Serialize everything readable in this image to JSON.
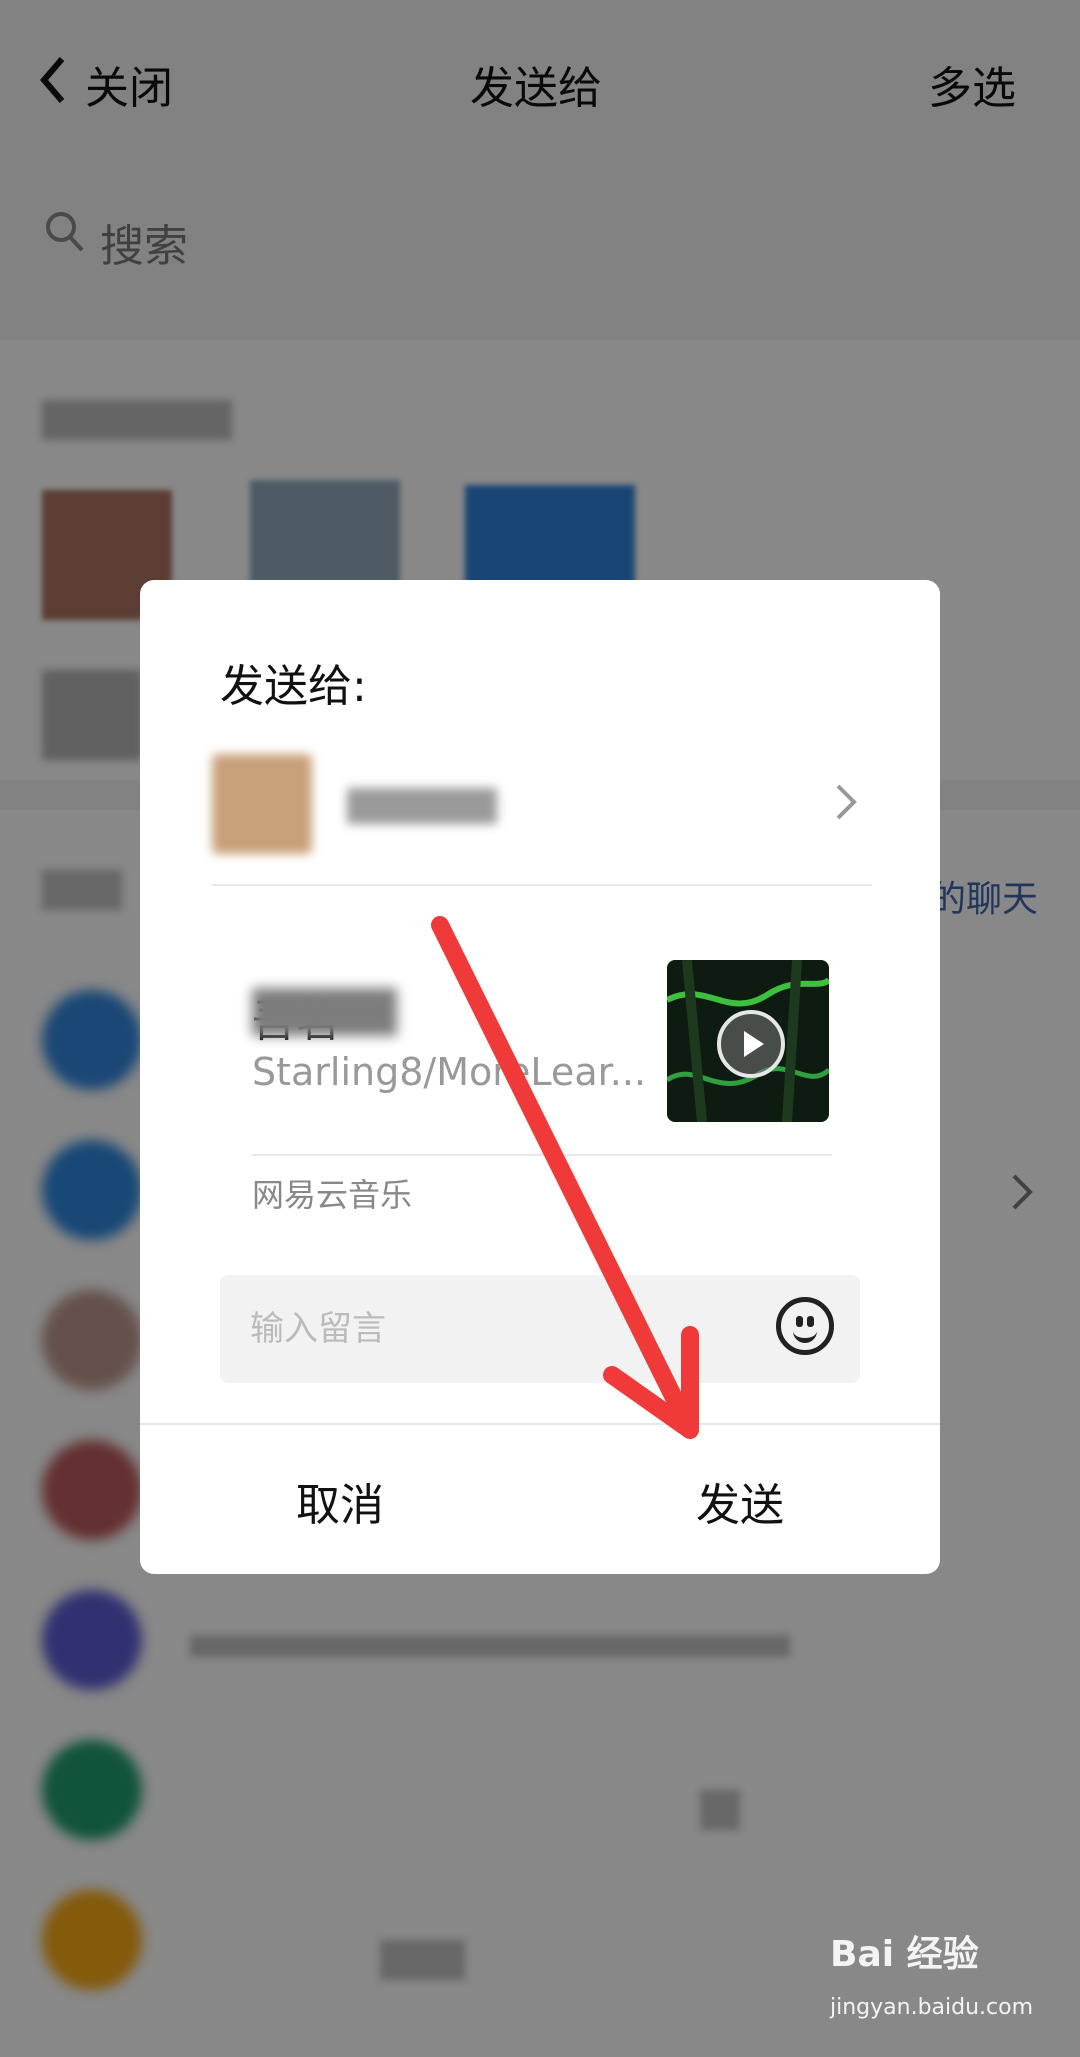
{
  "top_bar": {
    "close_label": "关闭",
    "title": "发送给",
    "multi_select_label": "多选"
  },
  "search": {
    "placeholder": "搜索"
  },
  "background": {
    "recent_link_fragment": "的聊天"
  },
  "dialog": {
    "title": "发送给:",
    "song": {
      "title_visible": "吾茗",
      "artist": "Starling8/MoreLear..."
    },
    "source": "网易云音乐",
    "message_placeholder": "输入留言",
    "cancel_label": "取消",
    "send_label": "发送"
  },
  "annotation": {
    "arrow_color": "#f03a3a"
  },
  "watermark": {
    "brand": "Bai 经验",
    "url": "jingyan.baidu.com"
  }
}
